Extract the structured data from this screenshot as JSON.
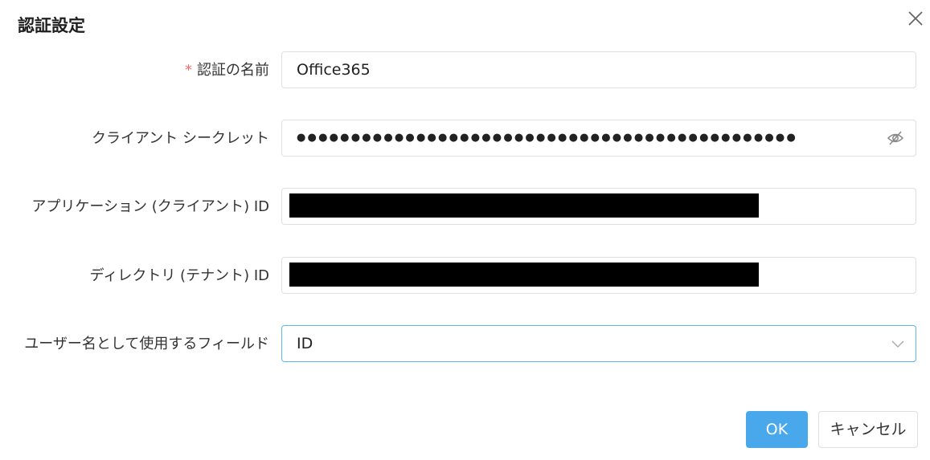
{
  "dialog": {
    "title": "認証設定",
    "close_icon": "close-icon"
  },
  "fields": {
    "auth_name": {
      "required_mark": "*",
      "label": "認証の名前",
      "value": "Office365"
    },
    "client_secret": {
      "label": "クライアント シークレット",
      "value": "●●●●●●●●●●●●●●●●●●●●●●●●●●●●●●●●●●●●●●●●●●●●●●",
      "icon": "eye-off-icon"
    },
    "application_id": {
      "label": "アプリケーション (クライアント) ID"
    },
    "directory_id": {
      "label": "ディレクトリ (テナント) ID"
    },
    "username_field": {
      "label": "ユーザー名として使用するフィールド",
      "value": "ID",
      "icon": "chevron-down-icon"
    }
  },
  "buttons": {
    "ok_label": "OK",
    "cancel_label": "キャンセル"
  },
  "colors": {
    "primary": "#48a8eb",
    "required": "#f56c6c",
    "border": "#dcdfe6",
    "focus_border": "#5fb6ef"
  }
}
